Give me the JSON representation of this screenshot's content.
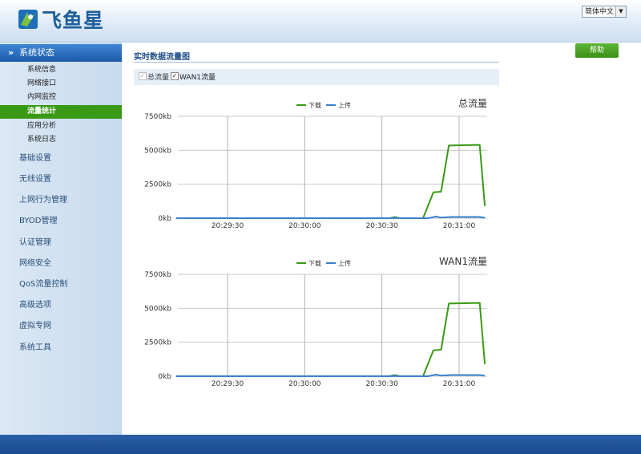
{
  "header": {
    "brand": "飞鱼星",
    "language": "简体中文"
  },
  "sidebar": {
    "section_title": "系统状态",
    "sub_items": [
      {
        "label": "系统信息",
        "active": false
      },
      {
        "label": "网络接口",
        "active": false
      },
      {
        "label": "内网监控",
        "active": false
      },
      {
        "label": "流量统计",
        "active": true
      },
      {
        "label": "应用分析",
        "active": false
      },
      {
        "label": "系统日志",
        "active": false
      }
    ],
    "items": [
      {
        "label": "基础设置"
      },
      {
        "label": "无线设置"
      },
      {
        "label": "上网行为管理"
      },
      {
        "label": "BYOD管理"
      },
      {
        "label": "认证管理"
      },
      {
        "label": "网络安全"
      },
      {
        "label": "QoS流量控制"
      },
      {
        "label": "高级选项"
      },
      {
        "label": "虚拟专网"
      },
      {
        "label": "系统工具"
      }
    ]
  },
  "main": {
    "help_label": "帮助",
    "page_title": "实时数据流量图",
    "filters": [
      {
        "label": "总流量",
        "checked": true,
        "disabled": true
      },
      {
        "label": "WAN1流量",
        "checked": true,
        "disabled": false
      }
    ]
  },
  "colors": {
    "download": "#3a9a16",
    "upload": "#3d7fd1",
    "accent": "#1c5aa8",
    "active": "#3a9a16"
  },
  "chart_data": [
    {
      "type": "line",
      "title": "总流量",
      "legend": [
        "下载",
        "上传"
      ],
      "legend_position": "top-center",
      "x_ticks": [
        "20:29:30",
        "20:30:00",
        "20:30:30",
        "20:31:00"
      ],
      "y_ticks": [
        "7500kb",
        "5000kb",
        "2500kb",
        "0kb"
      ],
      "ylim": [
        0,
        7500
      ],
      "grid": true,
      "series": [
        {
          "name": "下载",
          "points": [
            [
              "20:29:10",
              0
            ],
            [
              "20:30:33",
              0
            ],
            [
              "20:30:35",
              80
            ],
            [
              "20:30:37",
              0
            ],
            [
              "20:30:46",
              0
            ],
            [
              "20:30:50",
              1900
            ],
            [
              "20:30:53",
              1950
            ],
            [
              "20:30:56",
              5350
            ],
            [
              "20:31:08",
              5400
            ],
            [
              "20:31:10",
              900
            ]
          ]
        },
        {
          "name": "上传",
          "points": [
            [
              "20:29:10",
              0
            ],
            [
              "20:30:33",
              0
            ],
            [
              "20:30:35",
              20
            ],
            [
              "20:30:37",
              0
            ],
            [
              "20:30:48",
              0
            ],
            [
              "20:30:51",
              120
            ],
            [
              "20:30:53",
              40
            ],
            [
              "20:30:57",
              90
            ],
            [
              "20:31:08",
              90
            ],
            [
              "20:31:10",
              30
            ]
          ]
        }
      ]
    },
    {
      "type": "line",
      "title": "WAN1流量",
      "legend": [
        "下载",
        "上传"
      ],
      "legend_position": "top-center",
      "x_ticks": [
        "20:29:30",
        "20:30:00",
        "20:30:30",
        "20:31:00"
      ],
      "y_ticks": [
        "7500kb",
        "5000kb",
        "2500kb",
        "0kb"
      ],
      "ylim": [
        0,
        7500
      ],
      "grid": true,
      "series": [
        {
          "name": "下载",
          "points": [
            [
              "20:29:10",
              0
            ],
            [
              "20:30:33",
              0
            ],
            [
              "20:30:35",
              80
            ],
            [
              "20:30:37",
              0
            ],
            [
              "20:30:46",
              0
            ],
            [
              "20:30:50",
              1900
            ],
            [
              "20:30:53",
              1950
            ],
            [
              "20:30:56",
              5350
            ],
            [
              "20:31:08",
              5400
            ],
            [
              "20:31:10",
              900
            ]
          ]
        },
        {
          "name": "上传",
          "points": [
            [
              "20:29:10",
              0
            ],
            [
              "20:30:33",
              0
            ],
            [
              "20:30:35",
              20
            ],
            [
              "20:30:37",
              0
            ],
            [
              "20:30:48",
              0
            ],
            [
              "20:30:51",
              120
            ],
            [
              "20:30:53",
              40
            ],
            [
              "20:30:57",
              90
            ],
            [
              "20:31:08",
              90
            ],
            [
              "20:31:10",
              30
            ]
          ]
        }
      ]
    }
  ]
}
